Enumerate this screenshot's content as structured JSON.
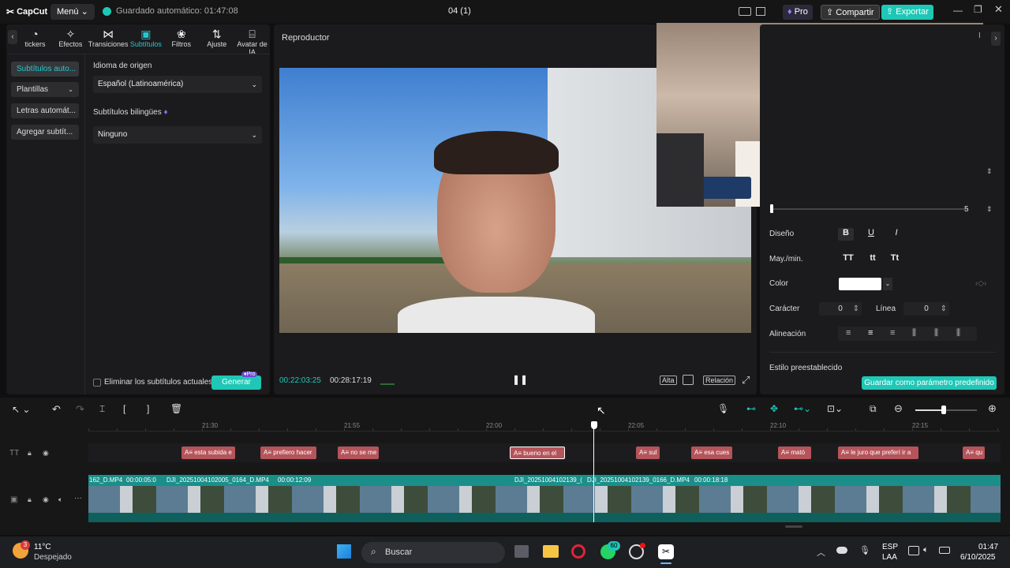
{
  "titlebar": {
    "logo": "CapCut",
    "menu": "Menú",
    "autosave": "Guardado automático: 01:47:08",
    "project": "04 (1)",
    "pro": "Pro",
    "share": "Compartir",
    "export": "Exportar"
  },
  "tabs": [
    {
      "label": "tickers",
      "icon": "sticker-icon"
    },
    {
      "label": "Efectos",
      "icon": "effects-icon"
    },
    {
      "label": "Transiciones",
      "icon": "transitions-icon"
    },
    {
      "label": "Subtítulos",
      "icon": "subtitles-icon"
    },
    {
      "label": "Filtros",
      "icon": "filters-icon"
    },
    {
      "label": "Ajuste",
      "icon": "adjust-icon"
    },
    {
      "label": "Avatar de IA",
      "icon": "ai-avatar-icon"
    }
  ],
  "sidebar": [
    "Subtítulos auto...",
    "Plantillas",
    "Letras automát...",
    "Agregar subtít..."
  ],
  "captions_panel": {
    "source_lang_label": "Idioma de origen",
    "source_lang_value": "Español (Latinoamérica)",
    "bilingual_label": "Subtítulos bilingües",
    "bilingual_value": "Ninguno",
    "delete_current": "Eliminar los subtítulos actuales",
    "generate": "Generar",
    "pro_badge": "Pro"
  },
  "player": {
    "title": "Reproductor",
    "current_time": "00:22:03:25",
    "total_time": "00:28:17:19",
    "quality": "Alta",
    "ratio": "Relación"
  },
  "properties": {
    "slider_value": "5",
    "design": "Diseño",
    "case": "May./min.",
    "case_opts": [
      "TT",
      "tt",
      "Tt"
    ],
    "color": "Color",
    "char": "Carácter",
    "char_value": "0",
    "line": "Línea",
    "line_value": "0",
    "align": "Alineación",
    "preset_style": "Estilo preestablecido",
    "save_preset": "Guardar como parámetro predefinido"
  },
  "timeline": {
    "ruler": [
      "21:30",
      "21:55",
      "22:00",
      "22:05",
      "22:10",
      "22:15"
    ],
    "captions": [
      "esta subida e",
      "prefiero hacer",
      "no se me",
      "bueno en el",
      "sul",
      "esa cues",
      "mató",
      "le juro que preferí ir a",
      "qu"
    ],
    "video_labels": [
      "162_D.MP4",
      "00:00:05:0",
      "DJI_20251004102005_0164_D.MP4",
      "00:00:12:09",
      "DJI_20251004102139_(",
      "DJI_20251004102139_0166_D.MP4",
      "00:00:18:18"
    ]
  },
  "taskbar": {
    "weather_temp": "11°C",
    "weather_desc": "Despejado",
    "weather_badge": "3",
    "search": "Buscar",
    "whatsapp_badge": "60",
    "lang1": "ESP",
    "lang2": "LAA",
    "time": "01:47",
    "date": "6/10/2025"
  },
  "colors": {
    "accent": "#1fc7b6",
    "caption_clip": "#b5545a",
    "video_track": "#1a8f8a"
  }
}
